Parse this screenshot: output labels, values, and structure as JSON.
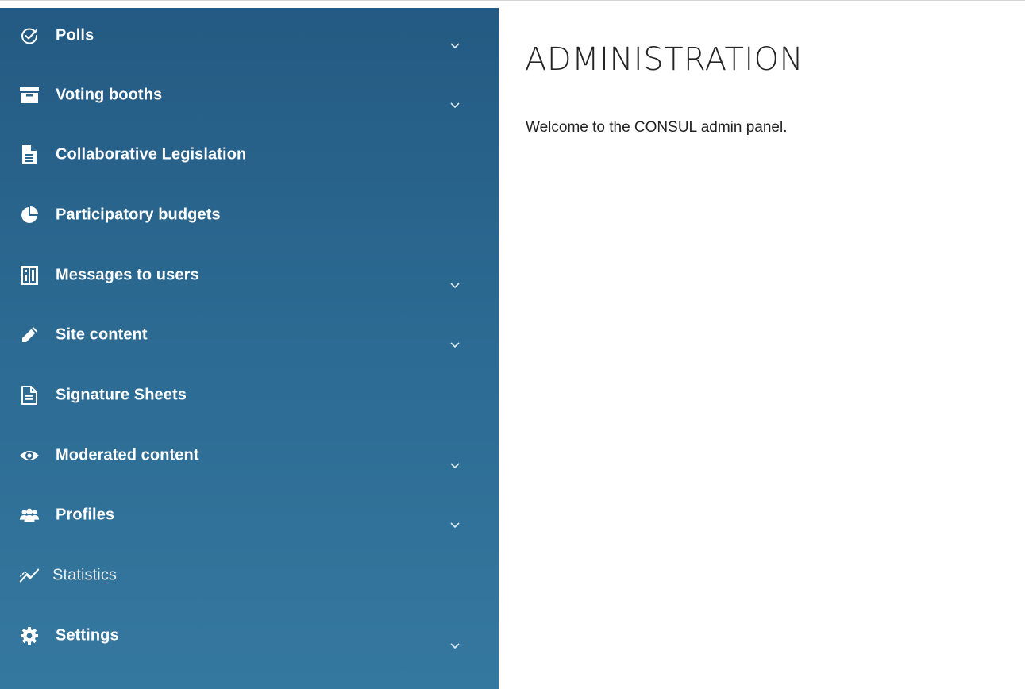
{
  "sidebar": {
    "items": [
      {
        "label": "Polls",
        "icon": "check-circle-icon",
        "expandable": true
      },
      {
        "label": "Voting booths",
        "icon": "archive-box-icon",
        "expandable": true
      },
      {
        "label": "Collaborative Legislation",
        "icon": "document-icon",
        "expandable": false
      },
      {
        "label": "Participatory budgets",
        "icon": "pie-chart-icon",
        "expandable": false
      },
      {
        "label": "Messages to users",
        "icon": "newsletter-icon",
        "expandable": true
      },
      {
        "label": "Site content",
        "icon": "pencil-icon",
        "expandable": true
      },
      {
        "label": "Signature Sheets",
        "icon": "signature-sheet-icon",
        "expandable": false
      },
      {
        "label": "Moderated content",
        "icon": "eye-icon",
        "expandable": true
      },
      {
        "label": "Profiles",
        "icon": "users-icon",
        "expandable": true
      },
      {
        "label": "Statistics",
        "icon": "stats-icon",
        "expandable": false
      },
      {
        "label": "Settings",
        "icon": "gear-icon",
        "expandable": true
      }
    ]
  },
  "main": {
    "title": "ADMINISTRATION",
    "welcome": "Welcome to the CONSUL admin panel."
  },
  "colors": {
    "sidebar_top": "#245a83",
    "sidebar_bottom": "#35789f",
    "text_dark": "#252525"
  }
}
